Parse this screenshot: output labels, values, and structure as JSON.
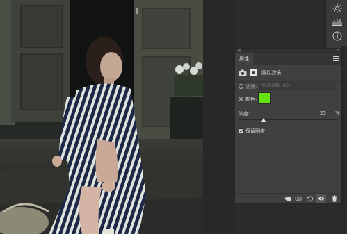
{
  "panel": {
    "close_glyph": "×",
    "collapse_glyph": "»",
    "tab_label": "属性",
    "header_title": "照片滤镜",
    "filter_label": "滤镜:",
    "filter_value": "加温滤镜 (85)",
    "color_label": "颜色:",
    "color_value": "#66e20f",
    "density_label": "浓度:",
    "density_value": "25",
    "density_unit": "%",
    "density_percent": 25,
    "preserve_label": "保留明度",
    "preserve_checked": true
  },
  "icons": {
    "dock": [
      "sun-icon",
      "levels-icon",
      "info-icon"
    ],
    "panel_header": [
      "camera-icon",
      "mask-icon"
    ],
    "panel_bottom": [
      "clip-to-layer-icon",
      "view-previous-state-icon",
      "reset-icon",
      "visibility-eye-icon",
      "delete-trash-icon"
    ]
  },
  "colors": {
    "panel_bg": "#404040",
    "app_bg": "#2b2b2b",
    "swatch": "#66e20f"
  }
}
